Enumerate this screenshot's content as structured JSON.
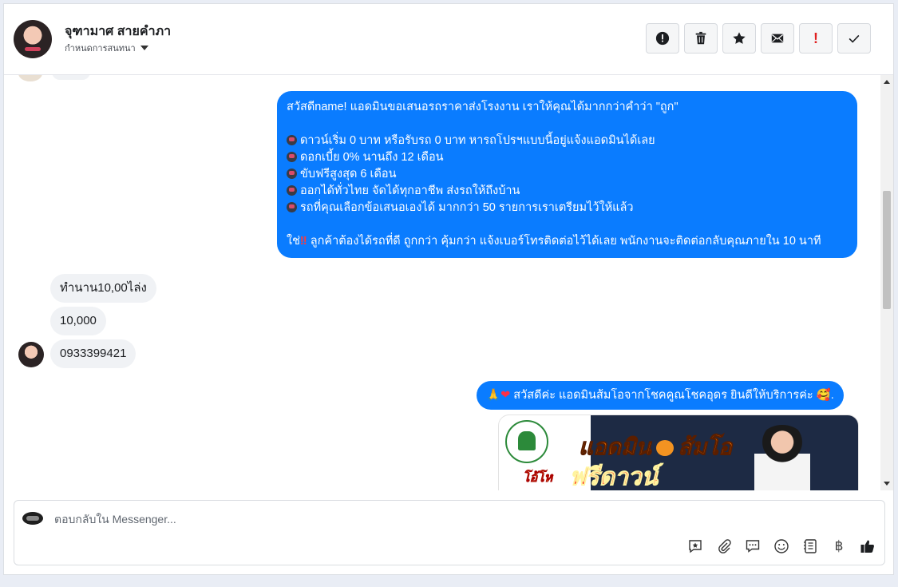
{
  "header": {
    "contact_name": "จุฑามาศ สายคำภา",
    "assign_label": "กำหนดการสนทนา",
    "actions": [
      {
        "name": "mark-spam-button",
        "icon": "exclamation-circle-icon"
      },
      {
        "name": "delete-button",
        "icon": "trash-icon"
      },
      {
        "name": "star-button",
        "icon": "star-icon"
      },
      {
        "name": "mark-unread-button",
        "icon": "envelope-icon"
      },
      {
        "name": "priority-button",
        "icon": "exclamation-icon",
        "text": "!"
      },
      {
        "name": "mark-done-button",
        "icon": "check-icon"
      }
    ]
  },
  "thread": {
    "outgoing_message": {
      "greeting": "สวัสดีname! แอดมินขอเสนอรถราคาส่งโรงงาน เราให้คุณได้มากกว่าคำว่า \"ถูก\"",
      "bullets": [
        "ดาวน์เริ่ม 0 บาท หรือรับรถ 0 บาท หารถโปรฯแบบนี้อยู่แจ้งแอดมินได้เลย",
        "ดอกเบี้ย 0% นานถึง 12 เดือน",
        "ขับฟรีสูงสุด 6 เดือน",
        "ออกได้ทั่วไทย จัดได้ทุกอาชีพ ส่งรถให้ถึงบ้าน",
        "รถที่คุณเลือกข้อเสนอเองได้ มากกว่า 50 รายการเราเตรียมไว้ให้แล้ว"
      ],
      "closing_prefix": "ใช่",
      "closing_mark": "‼",
      "closing_text": " ลูกค้าต้องได้รถที่ดี ถูกกว่า คุ้มกว่า แจ้งเบอร์โทรติดต่อไว้ได้เลย พนักงานจะติดต่อกลับคุณภายใน 10 นาที"
    },
    "incoming_messages": [
      "ทำนาน10,00ไล่ง",
      "10,000",
      "0933399421"
    ],
    "outgoing_reply": {
      "prefix_emoji": "🙏",
      "heart": "❤",
      "text": " สวัสดีค่ะ แอดมินส้มโอจากโชคคูณโชคอุดร ยินดีให้บริการค่ะ ",
      "suffix_emoji": "🥰."
    },
    "promo_image": {
      "headline": "แอดมิน",
      "headline_2": "ส้มโอ",
      "offer": "ฟรีดาวน์",
      "badge": "โอ้โห"
    }
  },
  "composer": {
    "placeholder": "ตอบกลับใน Messenger...",
    "value": "",
    "tools": [
      "saved-reply-icon",
      "attachment-icon",
      "chat-bubble-icon",
      "emoji-icon",
      "notes-icon",
      "baht-icon",
      "thumbs-up-icon"
    ],
    "baht_symbol": "฿"
  },
  "colors": {
    "outgoing_bubble": "#0a7cff",
    "incoming_bubble": "#f0f2f5"
  }
}
